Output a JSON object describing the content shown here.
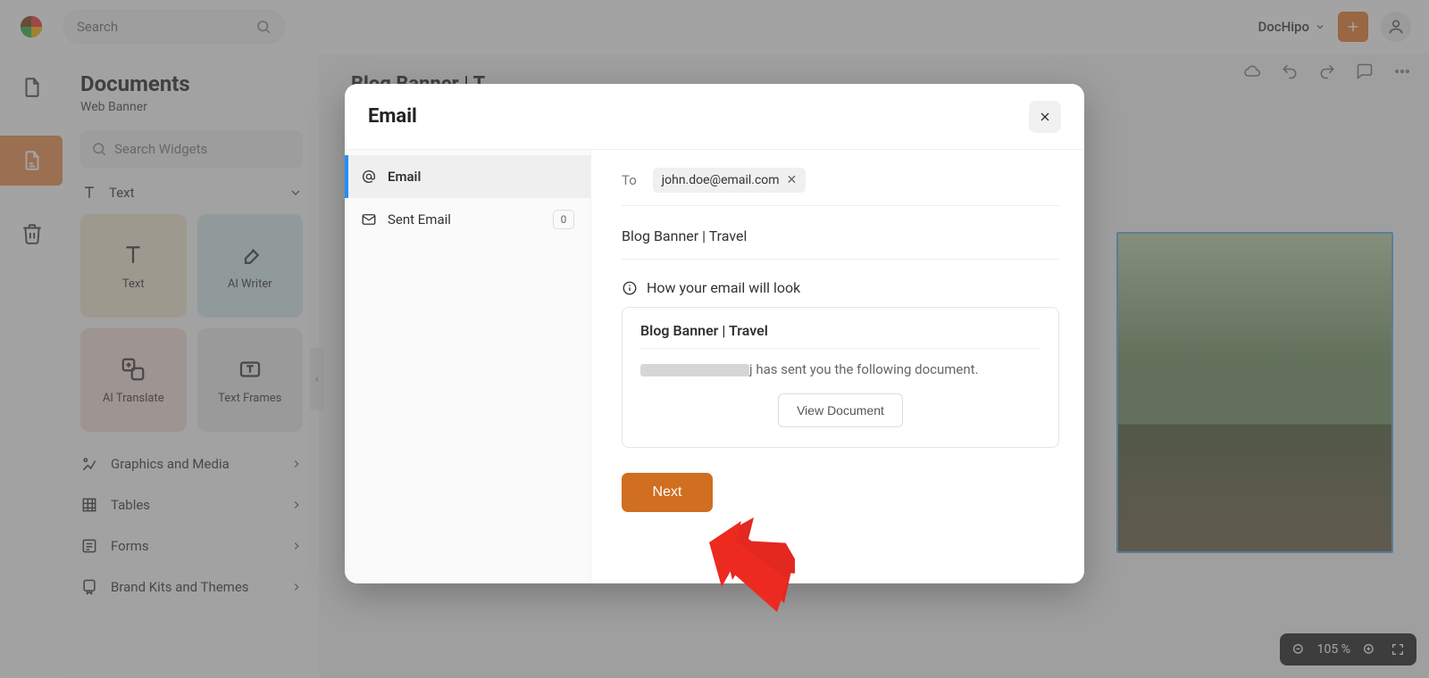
{
  "header": {
    "search_placeholder": "Search",
    "workspace_name": "DocHipo"
  },
  "panel": {
    "title": "Documents",
    "subtitle": "Web Banner",
    "widget_search_placeholder": "Search Widgets",
    "text_section": "Text",
    "tiles": {
      "text": "Text",
      "ai_writer": "AI Writer",
      "ai_translate": "AI Translate",
      "text_frames": "Text Frames"
    },
    "categories": {
      "graphics": "Graphics and Media",
      "tables": "Tables",
      "forms": "Forms",
      "brand": "Brand Kits and Themes"
    }
  },
  "canvas": {
    "doc_title_hint": "Blog Banner | T"
  },
  "zoom": {
    "value": "105 %"
  },
  "modal": {
    "title": "Email",
    "side": {
      "email": "Email",
      "sent": "Sent Email",
      "sent_count": "0"
    },
    "to_label": "To",
    "to_chip": "john.doe@email.com",
    "subject": "Blog Banner | Travel",
    "preview_label": "How your email will look",
    "preview_title": "Blog Banner | Travel",
    "preview_sender_tail": "j",
    "preview_suffix": " has sent you the following document.",
    "view_doc": "View Document",
    "next": "Next"
  }
}
